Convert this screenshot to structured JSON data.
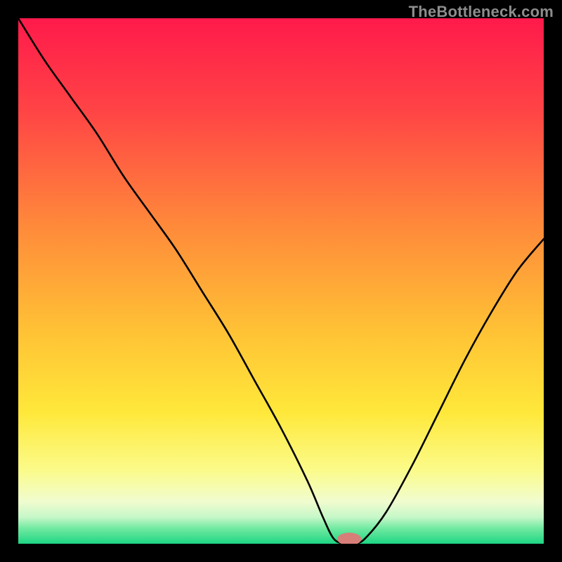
{
  "watermark": "TheBottleneck.com",
  "chart_data": {
    "type": "line",
    "title": "",
    "xlabel": "",
    "ylabel": "",
    "xlim": [
      0,
      100
    ],
    "ylim": [
      0,
      100
    ],
    "grid": false,
    "legend": false,
    "gradient_stops": [
      {
        "offset": 0,
        "color": "#ff1a4b"
      },
      {
        "offset": 18,
        "color": "#ff4545"
      },
      {
        "offset": 40,
        "color": "#ff8b3a"
      },
      {
        "offset": 60,
        "color": "#ffc335"
      },
      {
        "offset": 75,
        "color": "#ffe83a"
      },
      {
        "offset": 86,
        "color": "#fbfb8a"
      },
      {
        "offset": 92,
        "color": "#f0fccf"
      },
      {
        "offset": 95,
        "color": "#c5f7c8"
      },
      {
        "offset": 97,
        "color": "#74eaa2"
      },
      {
        "offset": 100,
        "color": "#1dd583"
      }
    ],
    "series": [
      {
        "name": "bottleneck-curve",
        "color": "#000000",
        "width": 2.6,
        "x": [
          0,
          5,
          10,
          15,
          20,
          25,
          30,
          35,
          40,
          45,
          50,
          55,
          58,
          60,
          62,
          64,
          66,
          70,
          75,
          80,
          85,
          90,
          95,
          100
        ],
        "y": [
          100,
          92,
          85,
          78,
          70,
          63,
          56,
          48,
          40,
          31,
          22,
          12,
          5,
          1,
          0,
          0,
          1,
          6,
          15,
          25,
          35,
          44,
          52,
          58
        ]
      }
    ],
    "marker": {
      "name": "optimal-point",
      "x": 63,
      "y": 0,
      "color": "#d87e78",
      "rx": 2.3,
      "ry": 1.2
    }
  }
}
